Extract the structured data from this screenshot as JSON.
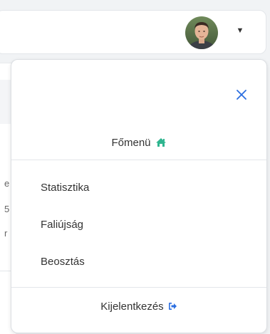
{
  "header": {
    "user_menu_caret": "▼"
  },
  "background": {
    "fragments": [
      "e",
      "5",
      "r"
    ]
  },
  "dropdown": {
    "title": "Főmenü",
    "items": [
      {
        "label": "Statisztika"
      },
      {
        "label": "Faliújság"
      },
      {
        "label": "Beosztás"
      }
    ],
    "logout_label": "Kijelentkezés"
  },
  "colors": {
    "home_icon": "#2fb58f",
    "logout_icon": "#2c6fe0",
    "close_icon": "#2c6fe0"
  }
}
